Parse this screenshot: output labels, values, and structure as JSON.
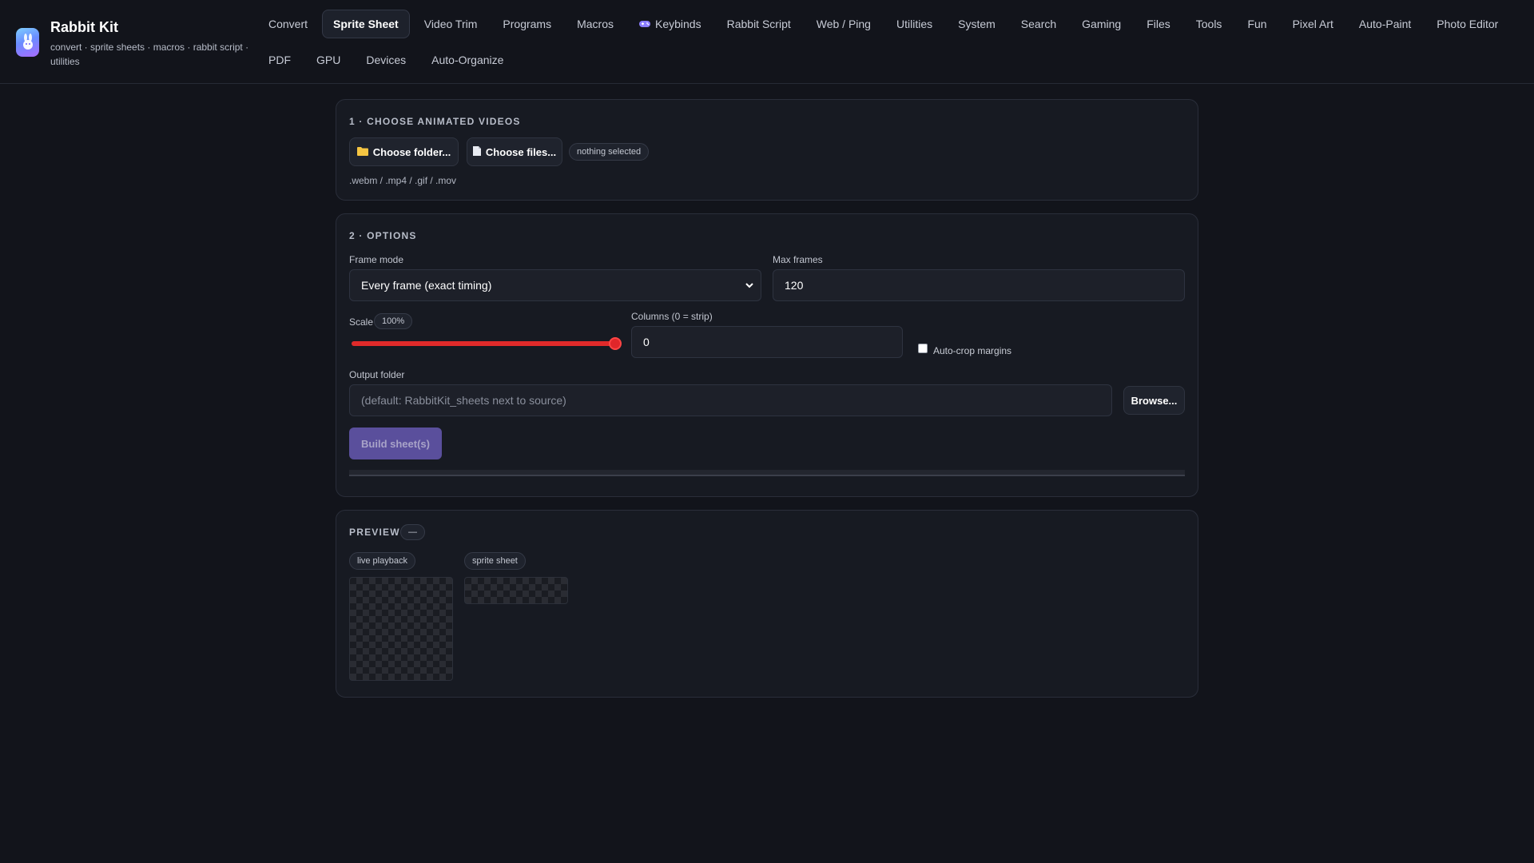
{
  "app": {
    "title": "Rabbit Kit",
    "subtitle": "convert · sprite sheets · macros · rabbit script · utilities",
    "logo_icon": "rabbit-icon"
  },
  "nav": {
    "row1": [
      {
        "label": "Convert",
        "active": false
      },
      {
        "label": "Sprite Sheet",
        "active": true
      },
      {
        "label": "Video Trim",
        "active": false
      },
      {
        "label": "Programs",
        "active": false
      },
      {
        "label": "Macros",
        "active": false
      },
      {
        "label": "Keybinds",
        "active": false,
        "icon": "gamepad-icon"
      },
      {
        "label": "Rabbit Script",
        "active": false
      },
      {
        "label": "Web / Ping",
        "active": false
      },
      {
        "label": "Utilities",
        "active": false
      },
      {
        "label": "System",
        "active": false
      },
      {
        "label": "Search",
        "active": false
      },
      {
        "label": "Gaming",
        "active": false
      },
      {
        "label": "Files",
        "active": false
      },
      {
        "label": "Tools",
        "active": false
      },
      {
        "label": "Fun",
        "active": false
      },
      {
        "label": "Pixel Art",
        "active": false
      },
      {
        "label": "Auto-Paint",
        "active": false
      },
      {
        "label": "Photo Editor",
        "active": false
      }
    ],
    "row2": [
      {
        "label": "PDF",
        "active": false
      },
      {
        "label": "GPU",
        "active": false
      },
      {
        "label": "Devices",
        "active": false
      },
      {
        "label": "Auto-Organize",
        "active": false
      }
    ]
  },
  "choose": {
    "title": "1 · CHOOSE ANIMATED VIDEOS",
    "folder_button": "Choose folder...",
    "files_button": "Choose files...",
    "status": "nothing selected",
    "formats": ".webm / .mp4 / .gif / .mov"
  },
  "options": {
    "title": "2 · OPTIONS",
    "frame_mode_label": "Frame mode",
    "frame_mode_value": "Every frame (exact timing)",
    "max_frames_label": "Max frames",
    "max_frames_value": "120",
    "scale_label": "Scale",
    "scale_value": "100%",
    "scale_fraction": 1.0,
    "columns_label": "Columns (0 = strip)",
    "columns_value": "0",
    "autocrop_label": "Auto-crop margins",
    "autocrop_checked": false,
    "output_label": "Output folder",
    "output_placeholder": "(default: RabbitKit_sheets next to source)",
    "browse_button": "Browse...",
    "build_button": "Build sheet(s)",
    "progress_fraction": 0
  },
  "preview": {
    "title": "PREVIEW",
    "status": "—",
    "live_label": "live playback",
    "sheet_label": "sprite sheet"
  },
  "colors": {
    "accent_red": "#e02a2a",
    "build_purple": "#5a4f9c",
    "background": "#12141b",
    "panel": "#171a22"
  }
}
